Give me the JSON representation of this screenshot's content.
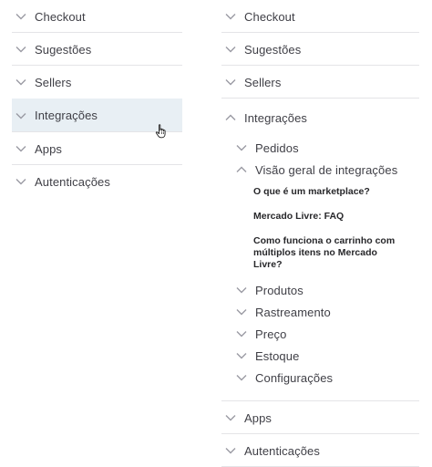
{
  "left_menu": [
    {
      "label": "Checkout"
    },
    {
      "label": "Sugestões"
    },
    {
      "label": "Sellers"
    },
    {
      "label": "Integrações"
    },
    {
      "label": "Apps"
    },
    {
      "label": "Autenticações"
    }
  ],
  "right_menu": {
    "top_items": [
      {
        "label": "Checkout"
      },
      {
        "label": "Sugestões"
      },
      {
        "label": "Sellers"
      }
    ],
    "expanded": {
      "label": "Integrações",
      "sub_before": [
        {
          "label": "Pedidos"
        }
      ],
      "sub_expanded": {
        "label": "Visão geral de integrações",
        "articles": [
          {
            "label": "O que é um marketplace?"
          },
          {
            "label": "Mercado Livre: FAQ"
          },
          {
            "label": "Como funciona o carrinho com múltiplos itens no Mercado Livre?"
          }
        ]
      },
      "sub_after": [
        {
          "label": "Produtos"
        },
        {
          "label": "Rastreamento"
        },
        {
          "label": "Preço"
        },
        {
          "label": "Estoque"
        },
        {
          "label": "Configurações"
        }
      ]
    },
    "bottom_items": [
      {
        "label": "Apps"
      },
      {
        "label": "Autenticações"
      }
    ]
  },
  "colors": {
    "hover_bg": "#e8eff4",
    "chevron": "#9a9aa3",
    "divider": "#e4e4e7"
  }
}
